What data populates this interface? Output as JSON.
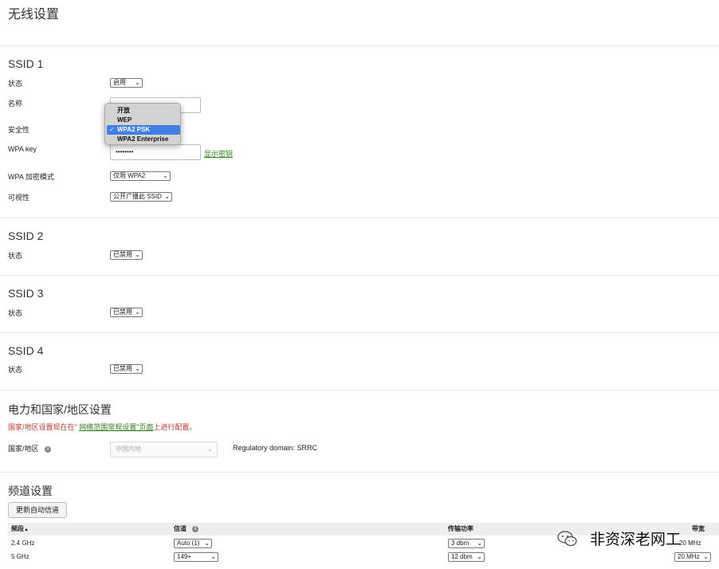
{
  "page_title": "无线设置",
  "ssid1": {
    "title": "SSID 1",
    "status_label": "状态",
    "status_value": "启用",
    "name_label": "名称",
    "name_value": "",
    "security_label": "安全性",
    "security_options": [
      "开放",
      "WEP",
      "WPA2 PSK",
      "WPA2 Enterprise"
    ],
    "security_selected": "WPA2 PSK",
    "check_mark": "✓",
    "wpakey_label": "WPA key",
    "wpakey_value": "••••••••",
    "show_key_link": "显示密钥",
    "encrypt_label": "WPA 加密模式",
    "encrypt_value": "仅限 WPA2",
    "visibility_label": "可视性",
    "visibility_value": "公开广播此 SSID"
  },
  "ssid2": {
    "title": "SSID 2",
    "status_label": "状态",
    "status_value": "已禁用"
  },
  "ssid3": {
    "title": "SSID 3",
    "status_label": "状态",
    "status_value": "已禁用"
  },
  "ssid4": {
    "title": "SSID 4",
    "status_label": "状态",
    "status_value": "已禁用"
  },
  "power": {
    "title": "电力和国家/地区设置",
    "warning_prefix": "国家/地区设置现在在\"",
    "warning_link": "网络范围常规设置\"页面",
    "warning_suffix": "上进行配置。",
    "country_label": "国家/地区",
    "info_icon": "i",
    "country_value": "中国内地",
    "regulatory": "Regulatory domain: SRRC"
  },
  "channel": {
    "title": "频道设置",
    "update_button": "更新自动信道",
    "headers": {
      "band": "频段",
      "sort_icon": "▲",
      "channel": "信道",
      "power": "传输功率",
      "width": "带宽"
    },
    "rows": [
      {
        "band": "2.4 GHz",
        "channel": "Auto (1)",
        "power": "3 dbm",
        "width": "20 MHz"
      },
      {
        "band": "5 GHz",
        "channel": "149+",
        "power": "12 dbm",
        "width": "20 MHz"
      }
    ]
  },
  "watermark": "非资深老网工",
  "caret": "⌄",
  "colors": {
    "link": "#2e7d1a",
    "warning": "#c0392b",
    "dropdown_highlight": "#3f7fe6"
  }
}
